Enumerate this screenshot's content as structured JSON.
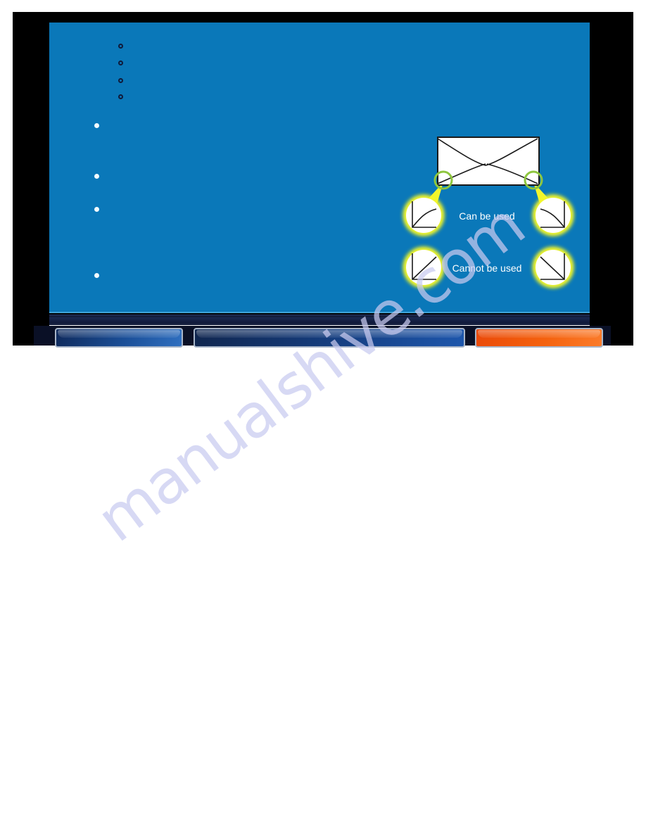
{
  "document": {
    "background_color": "#ffffff",
    "watermark": "manualshive.com"
  },
  "slide": {
    "frame_color": "#000000",
    "background_color": "#0a78b9",
    "hairline_color": "#3fa3d8",
    "sub_bullets": [
      {
        "marker": "hollow-circle",
        "text": ""
      },
      {
        "marker": "hollow-circle",
        "text": ""
      },
      {
        "marker": "hollow-circle",
        "text": ""
      },
      {
        "marker": "hollow-circle",
        "text": ""
      }
    ],
    "main_bullets": [
      {
        "marker": "filled-dot",
        "text": ""
      },
      {
        "marker": "filled-dot",
        "text": ""
      },
      {
        "marker": "filled-dot",
        "text": ""
      },
      {
        "marker": "filled-dot",
        "text": ""
      }
    ],
    "diagram": {
      "name": "envelope-flap-diagram",
      "envelope_fill": "#ffffff",
      "envelope_stroke": "#1a1a1a",
      "highlight_ring_color": "#8ec63f",
      "callout_glow_color": "#f2f62c",
      "callout_fill": "#ffffff",
      "label_color": "#ffffff",
      "labels": {
        "can_be_used": "Can be used",
        "cannot_be_used": "Cannot be used"
      },
      "callouts": [
        {
          "id": "can-left",
          "row": "can",
          "side": "left",
          "flap": "curved-up"
        },
        {
          "id": "can-right",
          "row": "can",
          "side": "right",
          "flap": "curved-down"
        },
        {
          "id": "cannot-left",
          "row": "cannot",
          "side": "left",
          "flap": "straight-up"
        },
        {
          "id": "cannot-right",
          "row": "cannot",
          "side": "right",
          "flap": "straight-down"
        }
      ]
    }
  },
  "footer": {
    "band_color": "#151f3e",
    "buttons": [
      {
        "name": "previous",
        "label": "",
        "color": "#1b4f98"
      },
      {
        "name": "contents",
        "label": "",
        "color": "#153d7e"
      },
      {
        "name": "next",
        "label": "",
        "color": "#f4620f"
      }
    ]
  }
}
